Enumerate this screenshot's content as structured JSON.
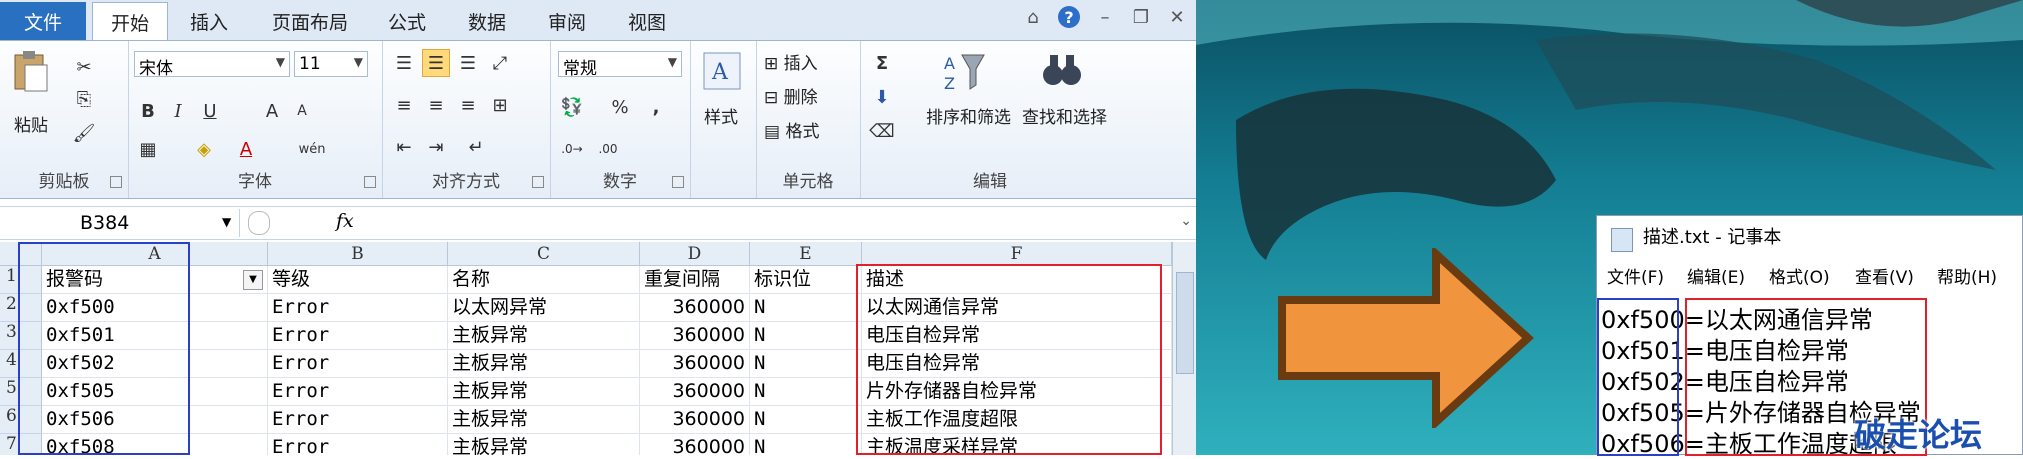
{
  "excel": {
    "tabs": [
      "文件",
      "开始",
      "插入",
      "页面布局",
      "公式",
      "数据",
      "审阅",
      "视图"
    ],
    "ribbon": {
      "clipboard": {
        "paste_label": "粘贴",
        "group_label": "剪贴板"
      },
      "font": {
        "name": "宋体",
        "size": "11",
        "group_label": "字体",
        "bold": "B",
        "italic": "I",
        "underline": "U",
        "grow": "A",
        "shrink": "A",
        "wen": "wén"
      },
      "alignment": {
        "group_label": "对齐方式"
      },
      "number": {
        "format": "常规",
        "percent": "%",
        "comma": ",",
        "group_label": "数字"
      },
      "styles": {
        "label": "样式"
      },
      "cells": {
        "insert": "插入",
        "delete": "删除",
        "format": "格式",
        "group_label": "单元格"
      },
      "editing": {
        "sigma": "Σ",
        "sort_filter": "排序和筛选",
        "find_select": "查找和选择",
        "group_label": "编辑"
      }
    },
    "name_box": "B384",
    "fx_label": "fx",
    "columns": [
      "A",
      "B",
      "C",
      "D",
      "E",
      "F"
    ],
    "header_row": {
      "a": "报警码",
      "b": "等级",
      "c": "名称",
      "d": "重复间隔",
      "e": "标识位",
      "f": "描述"
    },
    "rows": [
      {
        "num": "2",
        "a": "0xf500",
        "b": "Error",
        "c": "以太网异常",
        "d": "360000",
        "e": "N",
        "f": "以太网通信异常"
      },
      {
        "num": "3",
        "a": "0xf501",
        "b": "Error",
        "c": "主板异常",
        "d": "360000",
        "e": "N",
        "f": "电压自检异常"
      },
      {
        "num": "4",
        "a": "0xf502",
        "b": "Error",
        "c": "主板异常",
        "d": "360000",
        "e": "N",
        "f": "电压自检异常"
      },
      {
        "num": "5",
        "a": "0xf505",
        "b": "Error",
        "c": "主板异常",
        "d": "360000",
        "e": "N",
        "f": "片外存储器自检异常"
      },
      {
        "num": "6",
        "a": "0xf506",
        "b": "Error",
        "c": "主板异常",
        "d": "360000",
        "e": "N",
        "f": "主板工作温度超限"
      },
      {
        "num": "7",
        "a": "0xf508",
        "b": "Error",
        "c": "主板异常",
        "d": "360000",
        "e": "N",
        "f": "主板温度采样异常"
      }
    ],
    "first_row_num": "1"
  },
  "notepad": {
    "title": "描述.txt - 记事本",
    "menu": [
      "文件(F)",
      "编辑(E)",
      "格式(O)",
      "查看(V)",
      "帮助(H)"
    ],
    "lines": [
      {
        "code": "0xf500",
        "sep": "=",
        "desc": "以太网通信异常"
      },
      {
        "code": "0xf501",
        "sep": "=",
        "desc": "电压自检异常"
      },
      {
        "code": "0xf502",
        "sep": "=",
        "desc": "电压自检异常"
      },
      {
        "code": "0xf505",
        "sep": "=",
        "desc": "片外存储器自检异常"
      },
      {
        "code": "0xf506",
        "sep": "=",
        "desc": "主板工作温度超限"
      }
    ]
  },
  "watermark": "破走论坛",
  "colors": {
    "blue_box": "#2b3fc8",
    "red_box": "#e0202a",
    "arrow_fill": "#f0953e",
    "arrow_border": "#6a3a10"
  }
}
